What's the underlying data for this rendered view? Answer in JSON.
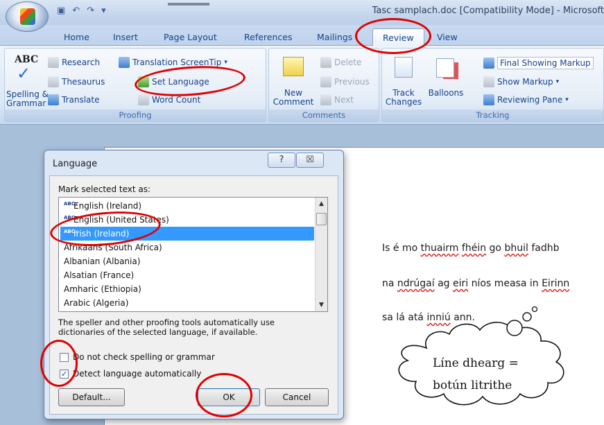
{
  "window": {
    "title": "Tasc samplach.doc [Compatibility Mode] - Microsoft"
  },
  "tabs": [
    {
      "label": "Home"
    },
    {
      "label": "Insert"
    },
    {
      "label": "Page Layout"
    },
    {
      "label": "References"
    },
    {
      "label": "Mailings"
    },
    {
      "label": "Review"
    },
    {
      "label": "View"
    }
  ],
  "ribbon": {
    "proofing": {
      "label": "Proofing",
      "spelling_line1": "Spelling &",
      "spelling_line2": "Grammar",
      "research": "Research",
      "thesaurus": "Thesaurus",
      "translate": "Translate",
      "translation_screentip": "Translation ScreenTip",
      "set_language": "Set Language",
      "word_count": "Word Count"
    },
    "comments": {
      "label": "Comments",
      "new_line1": "New",
      "new_line2": "Comment",
      "delete": "Delete",
      "previous": "Previous",
      "next": "Next"
    },
    "tracking": {
      "label": "Tracking",
      "track_line1": "Track",
      "track_line2": "Changes",
      "balloons": "Balloons",
      "final_showing_markup": "Final Showing Markup",
      "show_markup": "Show Markup",
      "reviewing_pane": "Reviewing Pane"
    }
  },
  "dialog": {
    "title": "Language",
    "help_label": "?",
    "close_label": "☒",
    "mark_label": "Mark selected text as:",
    "languages": [
      {
        "label": "English (Ireland)",
        "spell": true
      },
      {
        "label": "English (United States)",
        "spell": true
      },
      {
        "label": "Irish (Ireland)",
        "spell": true,
        "selected": true
      },
      {
        "label": "Afrikaans (South Africa)",
        "spell": false
      },
      {
        "label": "Albanian (Albania)",
        "spell": false
      },
      {
        "label": "Alsatian (France)",
        "spell": false
      },
      {
        "label": "Amharic (Ethiopia)",
        "spell": false
      },
      {
        "label": "Arabic (Algeria)",
        "spell": false
      }
    ],
    "info": "The speller and other proofing tools automatically use dictionaries of the selected language, if available.",
    "no_check": {
      "label": "Do not check spelling or grammar",
      "checked": false
    },
    "detect": {
      "label": "Detect language automatically",
      "checked": true
    },
    "default_button": "Default...",
    "ok_button": "OK",
    "cancel_button": "Cancel"
  },
  "document": {
    "line1": {
      "t1": "Is é mo ",
      "s1": "thuairm",
      "t2": " ",
      "s2": "fhéin",
      "t3": " go ",
      "s3": "bhuil",
      "t4": " fadhb"
    },
    "line2": {
      "t1": "na ",
      "s1": "ndrúgaí",
      "t2": " ag ",
      "s2": "eiri",
      "t3": " níos measa in ",
      "s3": "Eirinn"
    },
    "line3": {
      "t1": "sa lá atá ",
      "s1": "inniú",
      "t2": " ann."
    }
  },
  "annotation": {
    "line1": "Líne dhearg =",
    "line2": "botún litrithe"
  },
  "colors": {
    "annotation_red": "#e00000",
    "selection_blue": "#3399ff",
    "spelling_underline": "#e02020"
  }
}
